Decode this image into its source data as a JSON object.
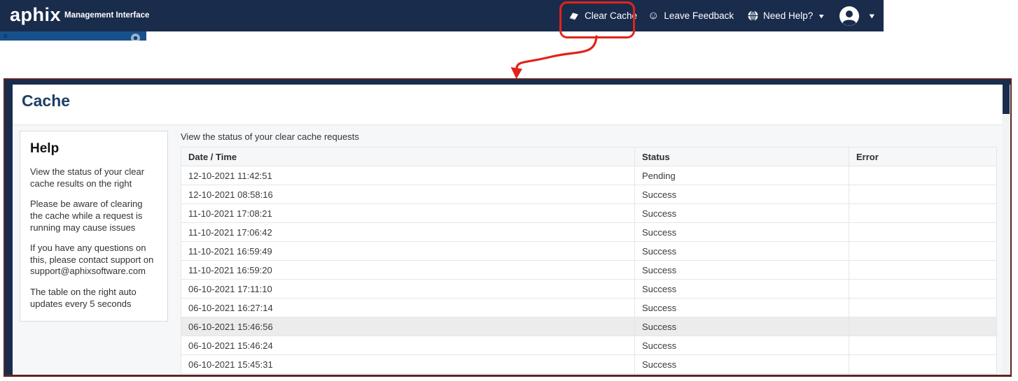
{
  "navbar": {
    "logo_text": "aphix",
    "subtitle": "Management Interface",
    "clear_cache_label": "Clear Cache",
    "leave_feedback_label": "Leave Feedback",
    "need_help_label": "Need Help?",
    "smiley_glyph": "☺"
  },
  "panel": {
    "title": "Cache",
    "table_caption": "View the status of your clear cache requests"
  },
  "help": {
    "heading": "Help",
    "paragraphs": [
      "View the status of your clear cache results on the right",
      "Please be aware of clearing the cache while a request is running may cause issues",
      "If you have any questions on this, please contact support on support@aphixsoftware.com",
      "The table on the right auto updates every 5 seconds"
    ]
  },
  "table": {
    "columns": [
      "Date / Time",
      "Status",
      "Error"
    ],
    "rows": [
      {
        "datetime": "12-10-2021 11:42:51",
        "status": "Pending",
        "error": "",
        "highlighted": false
      },
      {
        "datetime": "12-10-2021 08:58:16",
        "status": "Success",
        "error": "",
        "highlighted": false
      },
      {
        "datetime": "11-10-2021 17:08:21",
        "status": "Success",
        "error": "",
        "highlighted": false
      },
      {
        "datetime": "11-10-2021 17:06:42",
        "status": "Success",
        "error": "",
        "highlighted": false
      },
      {
        "datetime": "11-10-2021 16:59:49",
        "status": "Success",
        "error": "",
        "highlighted": false
      },
      {
        "datetime": "11-10-2021 16:59:20",
        "status": "Success",
        "error": "",
        "highlighted": false
      },
      {
        "datetime": "06-10-2021 17:11:10",
        "status": "Success",
        "error": "",
        "highlighted": false
      },
      {
        "datetime": "06-10-2021 16:27:14",
        "status": "Success",
        "error": "",
        "highlighted": false
      },
      {
        "datetime": "06-10-2021 15:46:56",
        "status": "Success",
        "error": "",
        "highlighted": true
      },
      {
        "datetime": "06-10-2021 15:46:24",
        "status": "Success",
        "error": "",
        "highlighted": false
      },
      {
        "datetime": "06-10-2021 15:45:31",
        "status": "Success",
        "error": "",
        "highlighted": false
      }
    ]
  },
  "colors": {
    "navbar_bg": "#1a2c4c",
    "sidebar_blue": "#17518b",
    "annotation_red": "#e2231a",
    "panel_border": "#5c2624",
    "title_text": "#1f3e66",
    "content_bg": "#f6f7f8",
    "row_highlight": "#ececec"
  }
}
